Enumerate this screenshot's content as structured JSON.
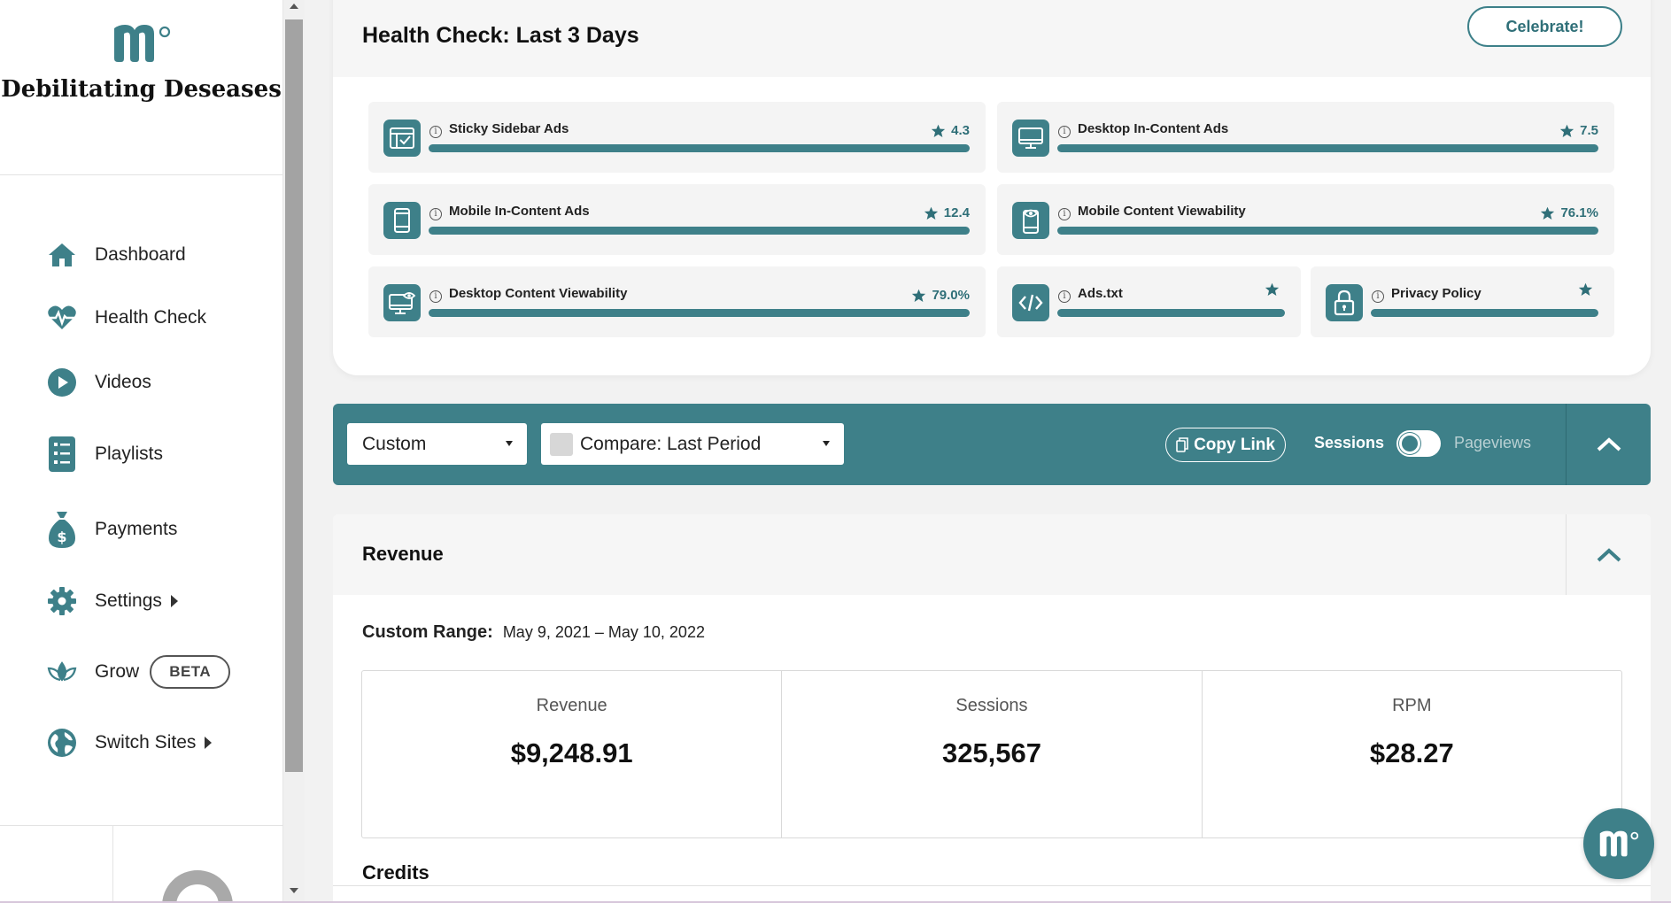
{
  "sidebar": {
    "site_name": "Debilitating Deseases",
    "items": [
      {
        "label": "Dashboard",
        "icon": "home-icon"
      },
      {
        "label": "Health Check",
        "icon": "heartbeat-icon"
      },
      {
        "label": "Videos",
        "icon": "play-circle-icon"
      },
      {
        "label": "Playlists",
        "icon": "checklist-icon"
      },
      {
        "label": "Payments",
        "icon": "money-bag-icon"
      },
      {
        "label": "Settings",
        "icon": "gear-icon"
      },
      {
        "label": "Grow",
        "icon": "lotus-icon",
        "badge": "BETA"
      },
      {
        "label": "Switch Sites",
        "icon": "globe-icon"
      }
    ]
  },
  "health": {
    "title": "Health Check: Last 3 Days",
    "celebrate_label": "Celebrate!",
    "tiles": [
      {
        "label": "Sticky Sidebar Ads",
        "score": "4.3",
        "icon": "sidebar-layout-icon"
      },
      {
        "label": "Desktop In-Content Ads",
        "score": "7.5",
        "icon": "monitor-icon"
      },
      {
        "label": "Mobile In-Content Ads",
        "score": "12.4",
        "icon": "mobile-icon"
      },
      {
        "label": "Mobile Content Viewability",
        "score": "76.1%",
        "icon": "mobile-eye-icon"
      },
      {
        "label": "Desktop Content Viewability",
        "score": "79.0%",
        "icon": "monitor-eye-icon"
      },
      {
        "label": "Ads.txt",
        "score": "",
        "icon": "code-icon"
      },
      {
        "label": "Privacy Policy",
        "score": "",
        "icon": "lock-icon"
      }
    ]
  },
  "filters": {
    "range_value": "Custom",
    "compare_value": "Compare: Last Period",
    "copy_link_label": "Copy Link",
    "sessions_label": "Sessions",
    "pageviews_label": "Pageviews"
  },
  "revenue": {
    "title": "Revenue",
    "range_label": "Custom Range:",
    "range_value": "May 9, 2021 – May 10, 2022",
    "stats": [
      {
        "label": "Revenue",
        "value": "$9,248.91"
      },
      {
        "label": "Sessions",
        "value": "325,567"
      },
      {
        "label": "RPM",
        "value": "$28.27"
      }
    ],
    "credits_title": "Credits"
  },
  "colors": {
    "accent": "#3e8089",
    "accent_dark": "#2f6f78"
  }
}
